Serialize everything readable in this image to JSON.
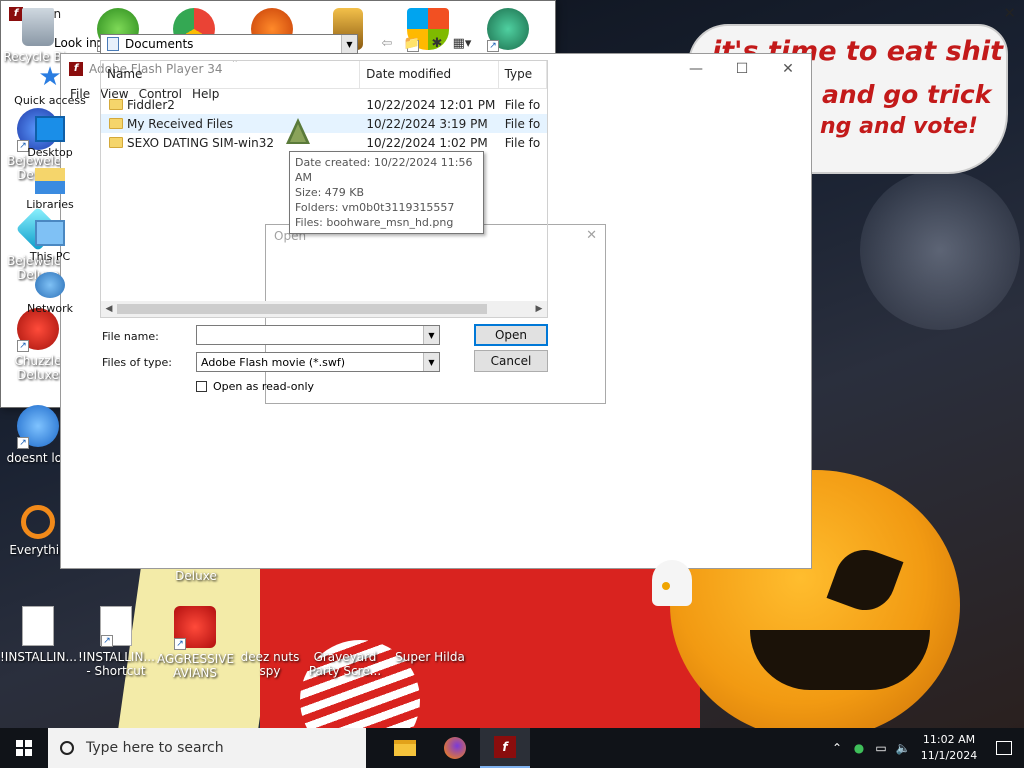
{
  "wallpaper": {
    "bubble_line1": "it's time to eat shit",
    "bubble_line2": "and go trick",
    "bubble_line3": "ng and vote!"
  },
  "desktop_icons": [
    {
      "label": "Recycle Bin",
      "icon": "recycle-bin-icon"
    },
    {
      "label": "Bejeweled Deluxe",
      "icon": "bejeweled-icon"
    },
    {
      "label": "Bejeweled Deluxe",
      "icon": "bejeweled-icon"
    },
    {
      "label": "Chuzzle Deluxe",
      "icon": "chuzzle-icon"
    },
    {
      "label": "doesnt loa",
      "icon": "bird-icon"
    },
    {
      "label": "Everythin",
      "icon": "search-tool-icon"
    },
    {
      "label": "!INSTALLIN...",
      "icon": "text-file-icon"
    },
    {
      "label": "!INSTALLIN... - Shortcut",
      "icon": "text-file-icon"
    },
    {
      "label": "AGGRESSIVE AVIANS",
      "icon": "angry-bird-icon"
    },
    {
      "label": "deez nuts spy",
      "icon": "app-icon"
    },
    {
      "label": "Graveyard Party Scre...",
      "icon": "app-icon"
    },
    {
      "label": "Super Hilda",
      "icon": "app-icon"
    },
    {
      "label": "Deluxe",
      "icon": "app-icon"
    }
  ],
  "flash_window": {
    "title": "Adobe Flash Player 34",
    "menu": [
      "File",
      "View",
      "Control",
      "Help"
    ]
  },
  "ghost_dialog": {
    "title": "Open"
  },
  "open_dialog": {
    "title": "Open",
    "look_in_label": "Look in:",
    "look_in_value": "Documents",
    "places": [
      "Quick access",
      "Desktop",
      "Libraries",
      "This PC",
      "Network"
    ],
    "columns": [
      "Name",
      "Date modified",
      "Type"
    ],
    "files": [
      {
        "name": "Fiddler2",
        "date": "10/22/2024 12:01 PM",
        "type": "File fo"
      },
      {
        "name": "My Received Files",
        "date": "10/22/2024 3:19 PM",
        "type": "File fo"
      },
      {
        "name": "SEXO DATING SIM-win32",
        "date": "10/22/2024 1:02 PM",
        "type": "File fo"
      }
    ],
    "tooltip": {
      "line1": "Date created: 10/22/2024 11:56 AM",
      "line2": "Size: 479 KB",
      "line3": "Folders: vm0b0t3119315557",
      "line4": "Files: boohware_msn_hd.png"
    },
    "file_name_label": "File name:",
    "file_name_value": "",
    "file_type_label": "Files of type:",
    "file_type_value": "Adobe Flash movie (*.swf)",
    "read_only_label": "Open as read-only",
    "open_button": "Open",
    "cancel_button": "Cancel"
  },
  "taskbar": {
    "search_placeholder": "Type here to search",
    "time": "11:02 AM",
    "date": "11/1/2024"
  }
}
